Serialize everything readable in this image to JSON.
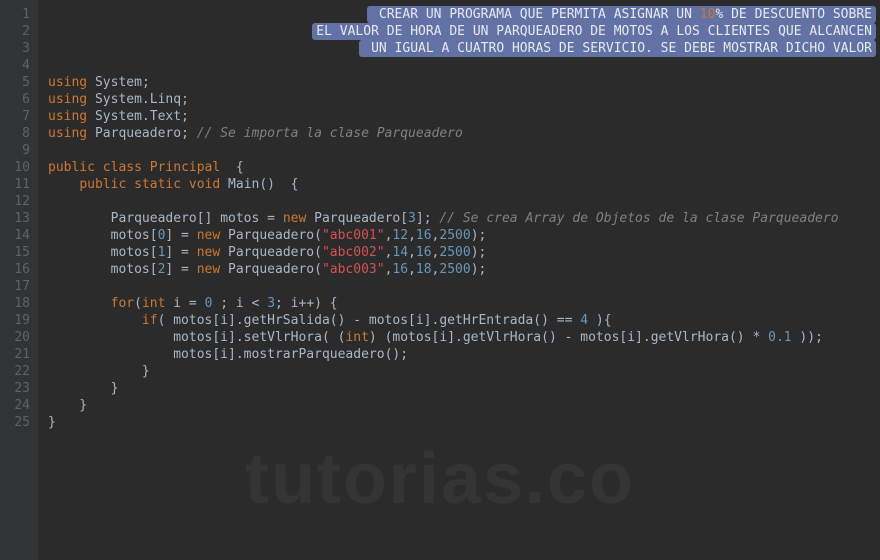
{
  "gutter": [
    "1",
    "2",
    "3",
    "4",
    "5",
    "6",
    "7",
    "8",
    "9",
    "10",
    "11",
    "12",
    "13",
    "14",
    "15",
    "16",
    "17",
    "18",
    "19",
    "20",
    "21",
    "22",
    "23",
    "24",
    "25"
  ],
  "selection": {
    "l1a": " CREAR UN PROGRAMA QUE PERMITA ASIGNAR UN ",
    "l1b": "10",
    "l1c": "% DE DESCUENTO SOBRE",
    "l2": "EL VALOR DE HORA DE UN PARQUEADERO DE MOTOS A LOS CLIENTES QUE ALCANCEN",
    "l3": " UN IGUAL A CUATRO HORAS DE SERVICIO. SE DEBE MOSTRAR DICHO VALOR"
  },
  "code": {
    "using": "using",
    "ns_system": "System",
    "ns_linq": "System.Linq",
    "ns_text": "System.Text",
    "ns_parq": "Parqueadero",
    "cmt_import": "// Se importa la clase Parqueadero",
    "public": "public",
    "class": "class",
    "cls_principal": "Principal",
    "static": "static",
    "void": "void",
    "main": "Main",
    "decl_arr": "Parqueadero[] motos = ",
    "new": "new",
    "arr_size": "3",
    "cmt_array": "// Se crea Array de Objetos de la clase Parqueadero",
    "idx0": "0",
    "idx1": "1",
    "idx2": "2",
    "str0": "\"abc001\"",
    "str1": "\"abc002\"",
    "str2": "\"abc003\"",
    "n12": "12",
    "n14": "14",
    "n16": "16",
    "n18": "18",
    "n2500": "2500",
    "for": "for",
    "int": "int",
    "i0": "0",
    "lt3": "3",
    "if": "if",
    "eq4": "4",
    "getHrSalida": "getHrSalida",
    "getHrEntrada": "getHrEntrada",
    "setVlrHora": "setVlrHora",
    "getVlrHora": "getVlrHora",
    "mostrar": "mostrarParqueadero",
    "dot1": "0.1"
  },
  "watermark": "tutorias.co"
}
